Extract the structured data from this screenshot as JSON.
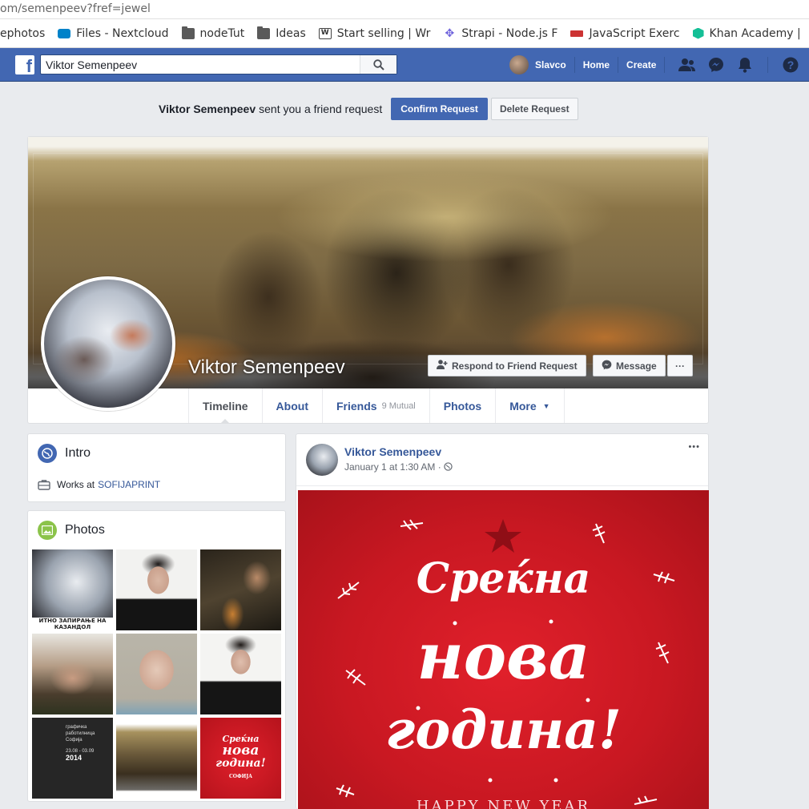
{
  "browser": {
    "url": "om/semenpeev?fref=jewel",
    "bookmarks": [
      {
        "label": "ephotos",
        "icon": "none"
      },
      {
        "label": "Files - Nextcloud",
        "icon": "nextcloud-icon"
      },
      {
        "label": "nodeTut",
        "icon": "folder-icon"
      },
      {
        "label": "Ideas",
        "icon": "folder-icon"
      },
      {
        "label": "Start selling | Wr",
        "icon": "w-icon"
      },
      {
        "label": "Strapi - Node.js F",
        "icon": "strapi-icon"
      },
      {
        "label": "JavaScript Exerc",
        "icon": "js-icon"
      },
      {
        "label": "Khan Academy |",
        "icon": "khan-icon"
      }
    ]
  },
  "header": {
    "search_value": "Viktor Semenpeev",
    "user_name": "Slavco",
    "home_label": "Home",
    "create_label": "Create",
    "brand_color": "#4267b2"
  },
  "friend_request": {
    "name": "Viktor Semenpeev",
    "text": "sent you a friend request",
    "confirm_label": "Confirm Request",
    "delete_label": "Delete Request"
  },
  "profile": {
    "name": "Viktor Semenpeev",
    "respond_label": "Respond to Friend Request",
    "message_label": "Message",
    "more_dots": "···",
    "tabs": [
      {
        "label": "Timeline"
      },
      {
        "label": "About"
      },
      {
        "label": "Friends",
        "extra": "9 Mutual"
      },
      {
        "label": "Photos"
      },
      {
        "label": "More"
      }
    ]
  },
  "intro": {
    "title": "Intro",
    "works_prefix": "Works at",
    "employer": "SOFIJAPRINT"
  },
  "photos": {
    "title": "Photos",
    "thumb_captions": {
      "t1": "ИТНО ЗАПИРАЊЕ НА КАЗАНДОЛ",
      "t7_line1": "графичка",
      "t7_line2": "работилница",
      "t7_line3": "Софија",
      "t7_dates": "23.08 - 03.09",
      "t7_year": "2014",
      "t9_line1": "Среќна",
      "t9_line2": "нова",
      "t9_line3": "година!",
      "t9_brand": "СОФИЈА"
    }
  },
  "post": {
    "author": "Viktor Semenpeev",
    "date": "January 1 at 1:30 AM",
    "sep": "·",
    "menu_dots": "•••",
    "image_text": {
      "line1": "Среќна",
      "line2": "нова",
      "line3": "година!",
      "line4": "HAPPY NEW YEAR"
    }
  }
}
